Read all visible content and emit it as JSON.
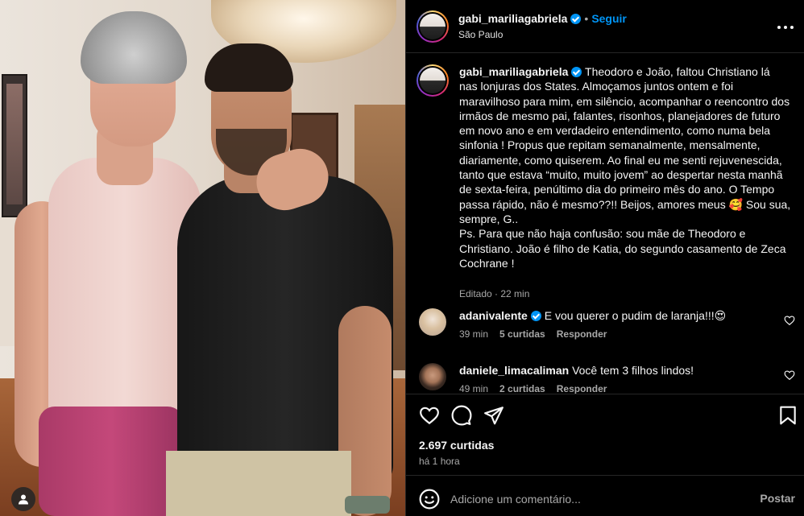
{
  "post": {
    "username": "gabi_mariliagabriela",
    "verified": true,
    "follow_label": "Seguir",
    "location": "São Paulo",
    "separator": "•"
  },
  "caption": {
    "username": "gabi_mariliagabriela",
    "text": "Theodoro e João, faltou Christiano lá nas lonjuras dos States. Almoçamos juntos ontem e foi maravilhoso para mim, em silêncio, acompanhar o reencontro dos irmãos de mesmo pai, falantes, risonhos, planejadores de futuro em novo ano e em verdadeiro entendimento, como numa bela sinfonia ! Propus que repitam semanalmente, mensalmente, diariamente, como quiserem. Ao final eu me senti rejuvenescida, tanto que estava “muito, muito jovem” ao despertar nesta manhã de sexta-feira, penúltimo dia do primeiro mês do ano. O Tempo passa rápido, não é mesmo??!! Beijos, amores meus 🥰 Sou sua, sempre, G..\nPs. Para que não haja confusão: sou mãe de Theodoro e Christiano. João é filho de Katia, do segundo casamento de Zeca Cochrane !",
    "edited_label": "Editado · 22 min"
  },
  "comments": [
    {
      "username": "adanivalente",
      "verified": true,
      "text": "E vou querer o pudim de laranja!!!😍",
      "time": "39 min",
      "likes": "5 curtidas",
      "reply": "Responder"
    },
    {
      "username": "daniele_limacaliman",
      "verified": false,
      "text": "Você tem 3 filhos lindos!",
      "time": "49 min",
      "likes": "2 curtidas",
      "reply": "Responder"
    }
  ],
  "stats": {
    "likes": "2.697 curtidas",
    "time": "há 1 hora"
  },
  "composer": {
    "placeholder": "Adicione um comentário...",
    "post_label": "Postar"
  },
  "icons": {
    "more": "more-options-icon",
    "like": "heart-icon",
    "comment": "comment-icon",
    "share": "share-icon",
    "save": "bookmark-icon",
    "emoji": "emoji-icon",
    "tag": "user-tag-icon"
  },
  "colors": {
    "background": "#000000",
    "accent": "#0095f6",
    "text": "#f5f5f5",
    "muted": "#a8a8a8",
    "divider": "#262626"
  }
}
